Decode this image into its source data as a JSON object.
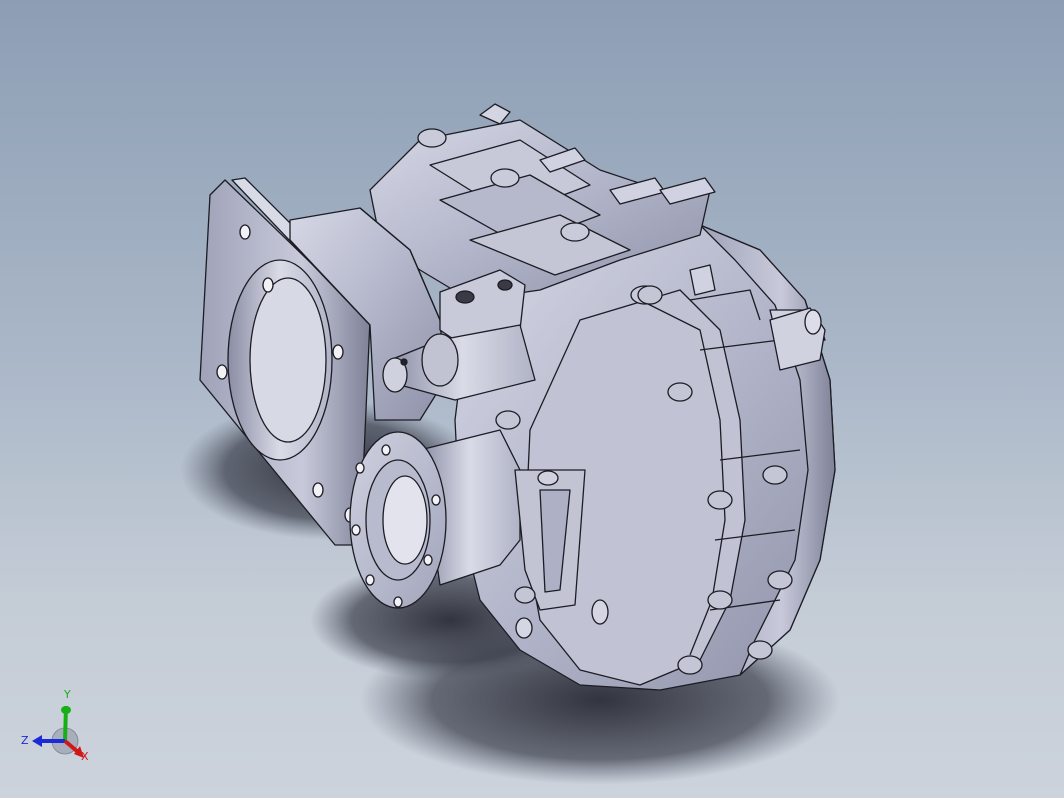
{
  "viewport": {
    "background_top": "#8d9eb4",
    "background_bottom": "#ccd3dc",
    "model_fill": "#b9bccf",
    "model_edge": "#1c1c24"
  },
  "triad": {
    "x_label": "X",
    "y_label": "Y",
    "z_label": "Z",
    "x_color": "#d01818",
    "y_color": "#16b016",
    "z_color": "#1a2ad8"
  }
}
